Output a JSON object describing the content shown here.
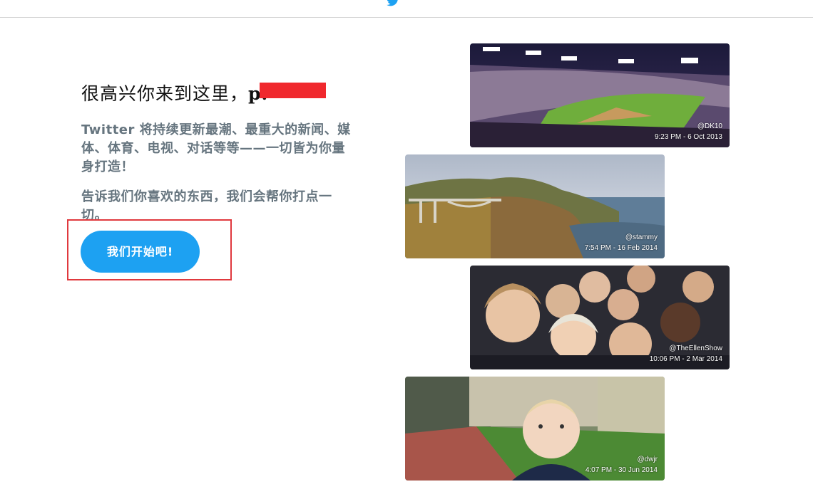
{
  "header": {
    "logo_icon": "twitter-bird-icon",
    "accent": "#1da1f2"
  },
  "welcome": {
    "headline": "很高兴你来到这里，",
    "headline_name_suffix": "p.",
    "intro_brand": "Twitter",
    "intro_text": " 将持续更新最潮、最重大的新闻、媒体、体育、电视、对话等等——一切皆为你量身打造！",
    "prompt_text": "告诉我们你喜欢的东西，我们会帮你打点一切。",
    "cta_label": "我们开始吧!"
  },
  "photos": [
    {
      "handle": "@DK10",
      "time": "9:23 PM - 6 Oct 2013"
    },
    {
      "handle": "@stammy",
      "time": "7:54 PM - 16 Feb 2014"
    },
    {
      "handle": "@TheEllenShow",
      "time": "10:06 PM - 2 Mar 2014"
    },
    {
      "handle": "@dwjr",
      "time": "4:07 PM - 30 Jun 2014"
    }
  ],
  "colors": {
    "redaction": "#f0282d",
    "highlight_border": "#e0393e",
    "body_text": "#66757f"
  }
}
